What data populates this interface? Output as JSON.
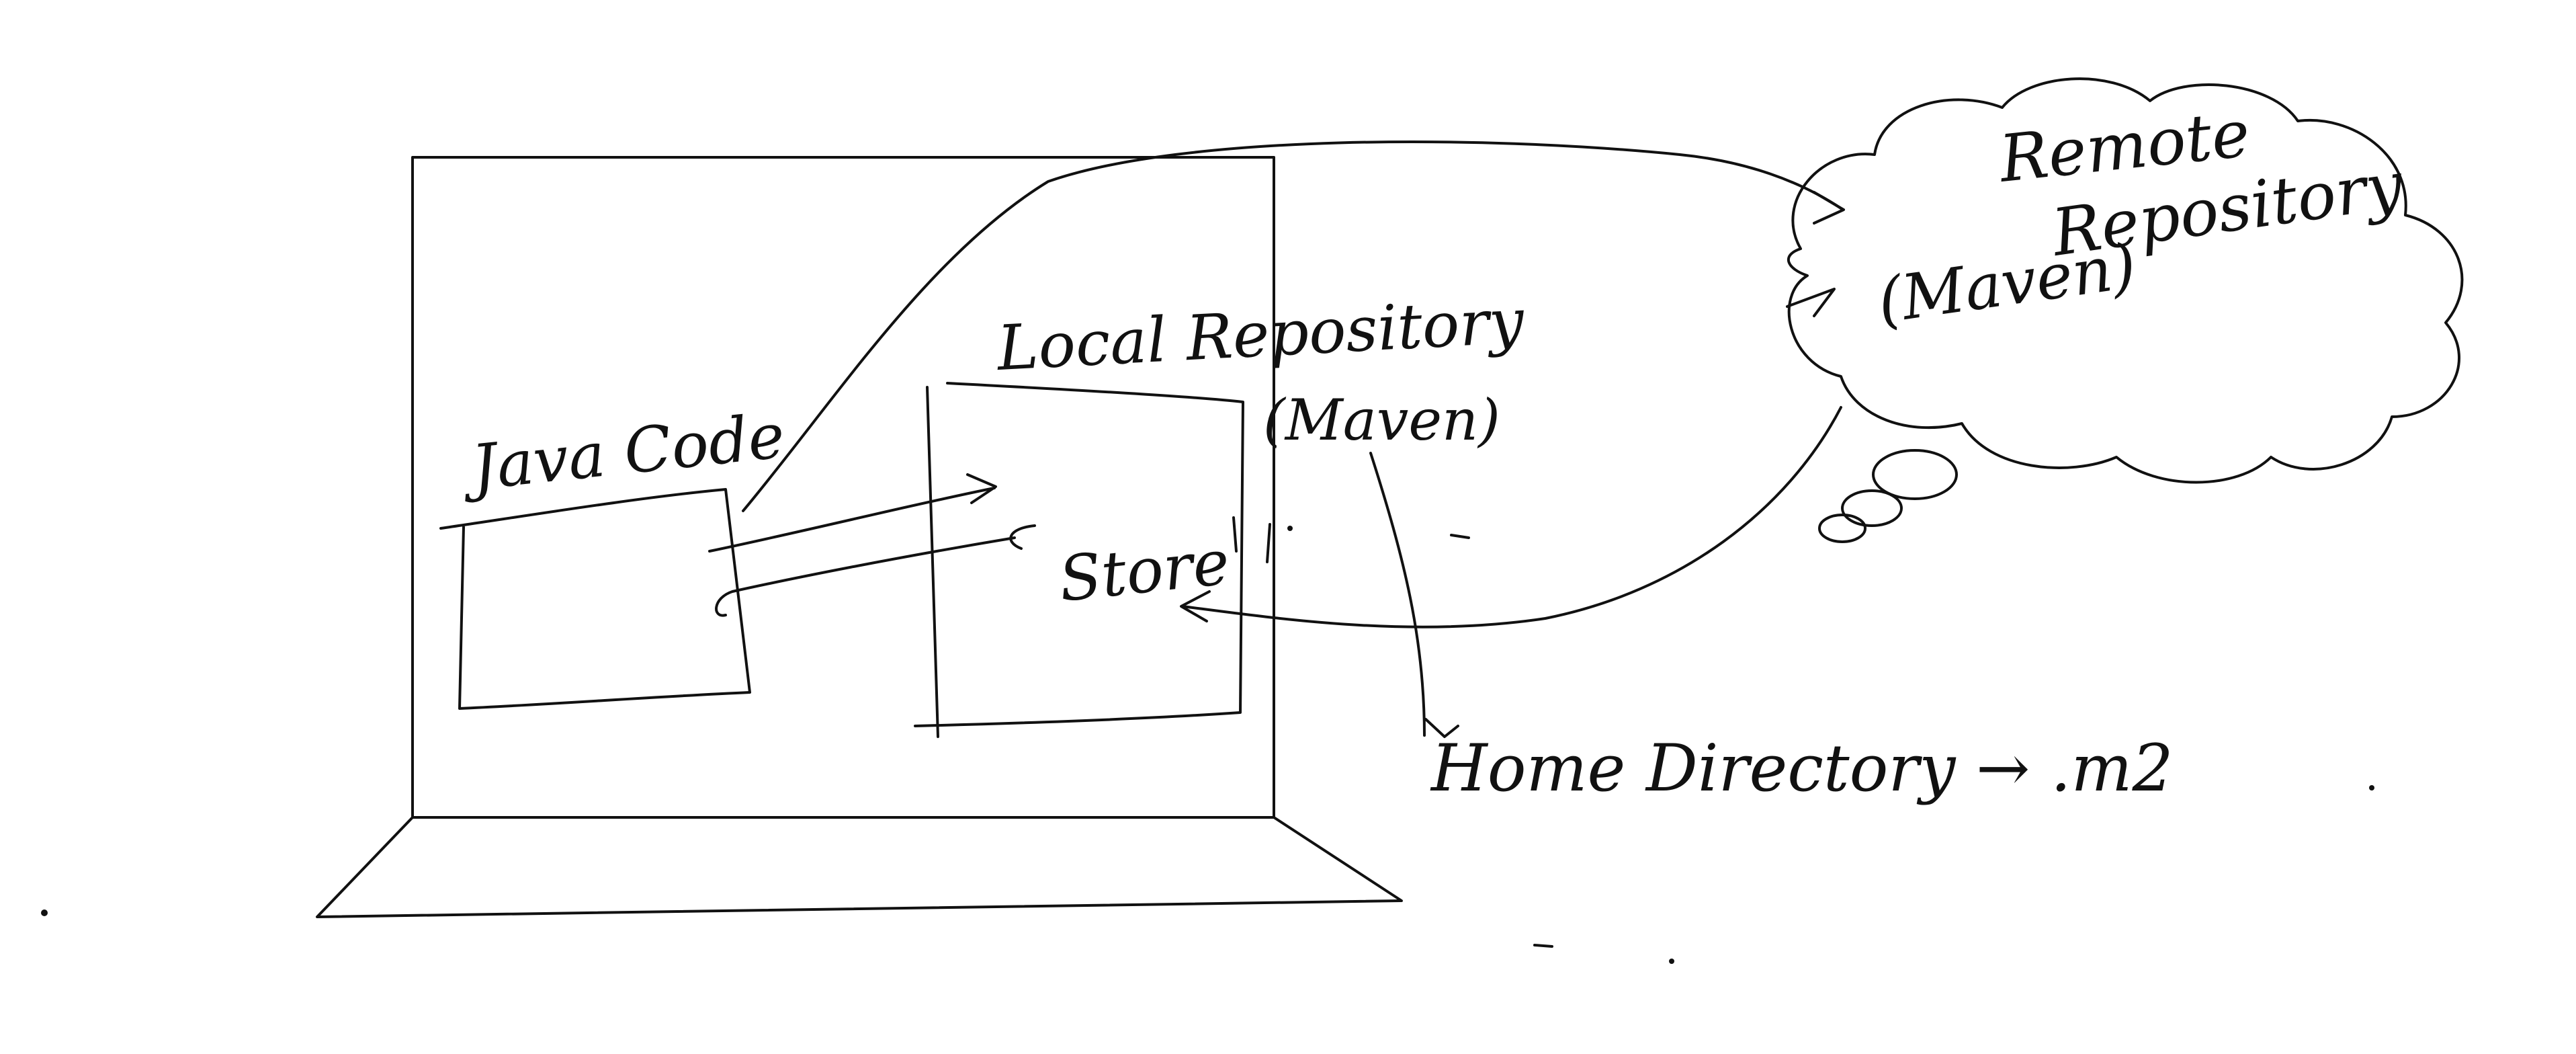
{
  "diagram": {
    "labels": {
      "java_code": "Java Code",
      "local_repository": "Local Repository",
      "local_maven": "(Maven)",
      "store": "Store",
      "home_directory": "Home Directory → .m2",
      "remote_line1": "Remote",
      "remote_line2": "Repository",
      "remote_maven": "(Maven)"
    },
    "colors": {
      "ink": "#111111",
      "background": "#ffffff"
    }
  }
}
